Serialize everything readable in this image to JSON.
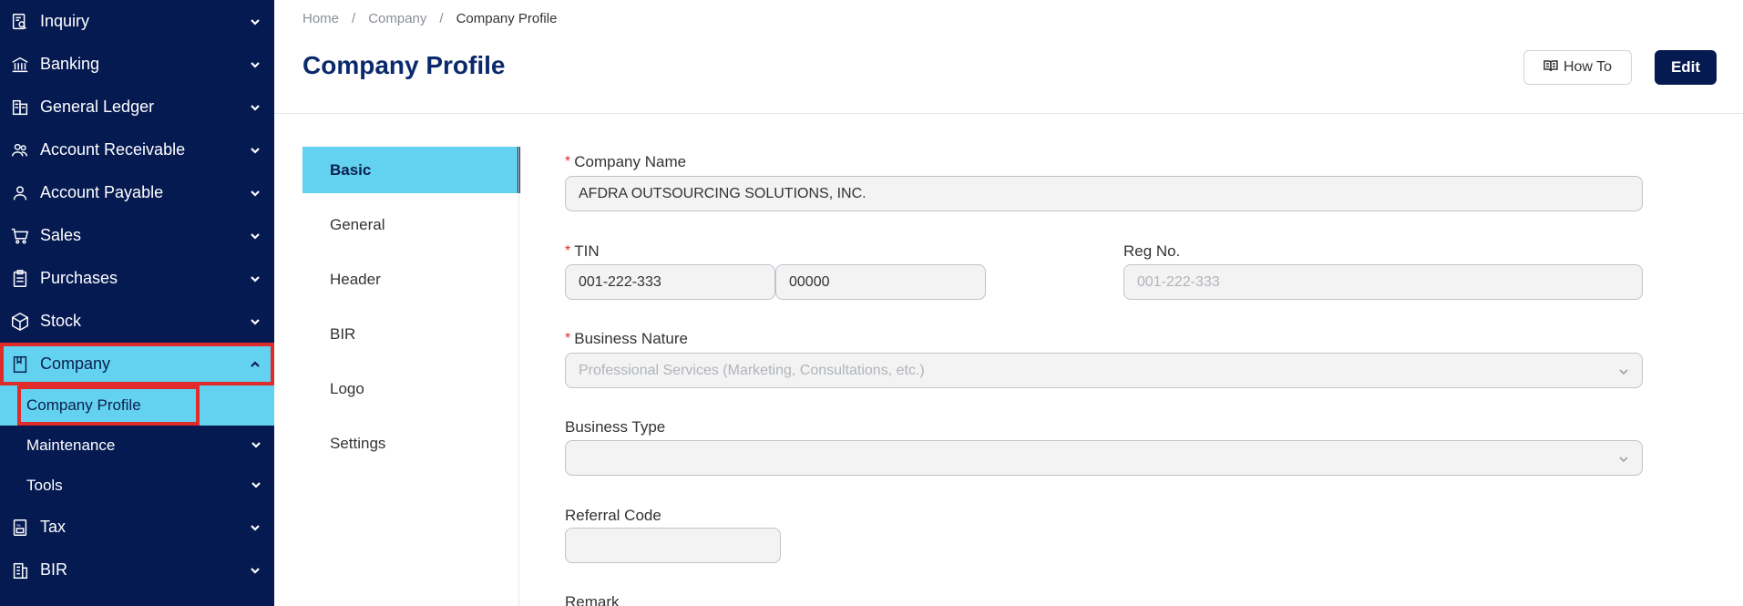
{
  "sidebar": {
    "items": [
      {
        "label": "Inquiry",
        "icon": "inquiry-icon"
      },
      {
        "label": "Banking",
        "icon": "bank-icon"
      },
      {
        "label": "General Ledger",
        "icon": "ledger-icon"
      },
      {
        "label": "Account Receivable",
        "icon": "users-icon"
      },
      {
        "label": "Account Payable",
        "icon": "user-icon"
      },
      {
        "label": "Sales",
        "icon": "cart-icon"
      },
      {
        "label": "Purchases",
        "icon": "clipboard-icon"
      },
      {
        "label": "Stock",
        "icon": "box-icon"
      },
      {
        "label": "Company",
        "icon": "bookmark-icon"
      }
    ],
    "company_sub": [
      {
        "label": "Company Profile"
      },
      {
        "label": "Maintenance"
      },
      {
        "label": "Tools"
      }
    ],
    "bottom_items": [
      {
        "label": "Tax",
        "icon": "tax-icon"
      },
      {
        "label": "BIR",
        "icon": "building-icon"
      }
    ]
  },
  "breadcrumb": {
    "home": "Home",
    "company": "Company",
    "current": "Company Profile",
    "separator": "/"
  },
  "header": {
    "title": "Company Profile",
    "howto_label": "How To",
    "edit_label": "Edit"
  },
  "tabs": [
    {
      "label": "Basic"
    },
    {
      "label": "General"
    },
    {
      "label": "Header"
    },
    {
      "label": "BIR"
    },
    {
      "label": "Logo"
    },
    {
      "label": "Settings"
    }
  ],
  "form": {
    "company_name": {
      "label": "Company Name",
      "value": "AFDRA OUTSOURCING SOLUTIONS, INC."
    },
    "tin": {
      "label": "TIN",
      "value1": "001-222-333",
      "value2": "00000"
    },
    "reg_no": {
      "label": "Reg No.",
      "placeholder": "001-222-333"
    },
    "business_nature": {
      "label": "Business Nature",
      "placeholder": "Professional Services (Marketing, Consultations, etc.)"
    },
    "business_type": {
      "label": "Business Type",
      "value": ""
    },
    "referral_code": {
      "label": "Referral Code",
      "value": ""
    },
    "remark": {
      "label": "Remark"
    },
    "required_mark": "*"
  },
  "colors": {
    "sidebar_bg": "#061a52",
    "active_bg": "#63d2f0",
    "highlight_border": "#e02b2b",
    "title": "#0b2a6b"
  }
}
